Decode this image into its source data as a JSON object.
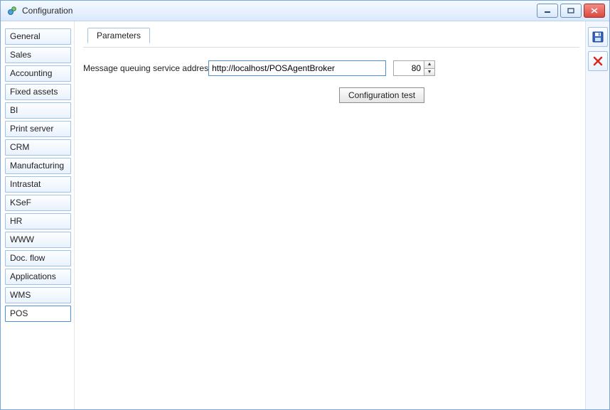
{
  "window": {
    "title": "Configuration"
  },
  "sidebar": {
    "items": [
      {
        "label": "General"
      },
      {
        "label": "Sales"
      },
      {
        "label": "Accounting"
      },
      {
        "label": "Fixed assets"
      },
      {
        "label": "BI"
      },
      {
        "label": "Print server"
      },
      {
        "label": "CRM"
      },
      {
        "label": "Manufacturing"
      },
      {
        "label": "Intrastat"
      },
      {
        "label": "KSeF"
      },
      {
        "label": "HR"
      },
      {
        "label": "WWW"
      },
      {
        "label": "Doc. flow"
      },
      {
        "label": "Applications"
      },
      {
        "label": "WMS"
      },
      {
        "label": "POS"
      }
    ],
    "active_index": 15
  },
  "tabs": {
    "items": [
      {
        "label": "Parameters"
      }
    ],
    "active_index": 0
  },
  "form": {
    "address_label": "Message queuing service addres",
    "address_value": "http://localhost/POSAgentBroker",
    "port_value": "80",
    "config_test_label": "Configuration test"
  },
  "icons": {
    "save": "save",
    "cancel": "cancel"
  },
  "colors": {
    "accent_border": "#4a90d9",
    "close_red": "#d94a3f"
  }
}
